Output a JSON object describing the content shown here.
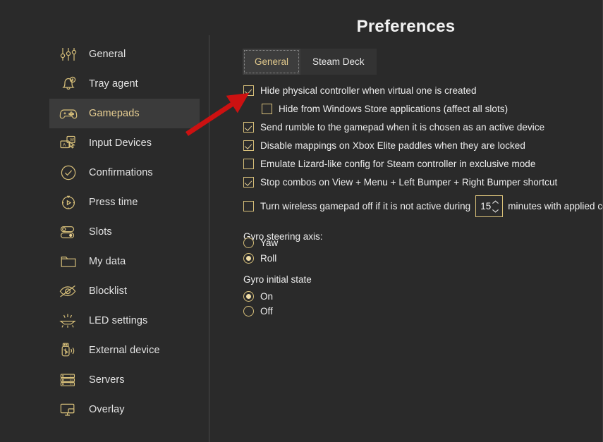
{
  "header": {
    "title": "Preferences"
  },
  "sidebar": {
    "items": [
      {
        "label": "General",
        "icon": "sliders-icon",
        "selected": false
      },
      {
        "label": "Tray agent",
        "icon": "bell-bolt-icon",
        "selected": false
      },
      {
        "label": "Gamepads",
        "icon": "gamepad-icon",
        "selected": true
      },
      {
        "label": "Input Devices",
        "icon": "keyboard-mouse-icon",
        "selected": false
      },
      {
        "label": "Confirmations",
        "icon": "check-circle-icon",
        "selected": false
      },
      {
        "label": "Press time",
        "icon": "stopwatch-play-icon",
        "selected": false
      },
      {
        "label": "Slots",
        "icon": "toggles-icon",
        "selected": false
      },
      {
        "label": "My data",
        "icon": "folder-icon",
        "selected": false
      },
      {
        "label": "Blocklist",
        "icon": "eye-slash-icon",
        "selected": false
      },
      {
        "label": "LED settings",
        "icon": "led-light-icon",
        "selected": false
      },
      {
        "label": "External device",
        "icon": "usb-bluetooth-icon",
        "selected": false
      },
      {
        "label": "Servers",
        "icon": "servers-icon",
        "selected": false
      },
      {
        "label": "Overlay",
        "icon": "monitor-overlay-icon",
        "selected": false
      }
    ]
  },
  "tabs": [
    {
      "label": "General",
      "active": true
    },
    {
      "label": "Steam Deck",
      "active": false
    }
  ],
  "options": [
    {
      "label": "Hide physical controller when virtual one is created",
      "checked": true,
      "indent": false
    },
    {
      "label": "Hide from Windows Store applications (affect all slots)",
      "checked": false,
      "indent": true
    },
    {
      "label": "Send rumble to the gamepad when it is chosen as an active device",
      "checked": true,
      "indent": false
    },
    {
      "label": "Disable mappings on Xbox Elite paddles when they are locked",
      "checked": true,
      "indent": false
    },
    {
      "label": "Emulate Lizard-like config for Steam controller in exclusive mode",
      "checked": false,
      "indent": false
    },
    {
      "label": "Stop combos on View + Menu + Left Bumper + Right Bumper shortcut",
      "checked": true,
      "indent": false
    }
  ],
  "wireless_timeout": {
    "checked": false,
    "label_before": "Turn wireless gamepad off if it is not active during",
    "value": "15",
    "label_after": "minutes with applied config"
  },
  "gyro_steering": {
    "heading": "Gyro steering axis:",
    "options": [
      {
        "label": "Yaw",
        "selected": false
      },
      {
        "label": "Roll",
        "selected": true
      }
    ]
  },
  "gyro_initial": {
    "heading": "Gyro initial state",
    "options": [
      {
        "label": "On",
        "selected": true
      },
      {
        "label": "Off",
        "selected": false
      }
    ]
  },
  "annotation": {
    "type": "red-arrow",
    "color": "#cc1111",
    "points_to": "Hide physical controller when virtual one is created"
  },
  "colors": {
    "background": "#2a2a2a",
    "selected_row": "#3b3b3b",
    "accent_gold": "#d8c07a",
    "accent_text": "#e8cf93",
    "text": "#eeeeee",
    "tab_bar": "#333333",
    "tab_active": "#3d3d3d"
  }
}
